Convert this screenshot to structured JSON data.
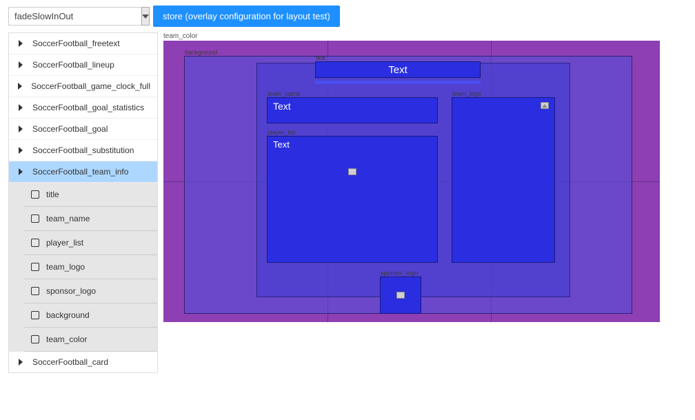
{
  "topbar": {
    "select_value": "fadeSlowInOut",
    "store_button": "store (overlay configuration for layout test)"
  },
  "sidebar": {
    "items": [
      {
        "label": "SoccerFootball_freetext",
        "kind": "parent"
      },
      {
        "label": "SoccerFootball_lineup",
        "kind": "parent"
      },
      {
        "label": "SoccerFootball_game_clock_full",
        "kind": "parent"
      },
      {
        "label": "SoccerFootball_goal_statistics",
        "kind": "parent"
      },
      {
        "label": "SoccerFootball_goal",
        "kind": "parent"
      },
      {
        "label": "SoccerFootball_substitution",
        "kind": "parent"
      },
      {
        "label": "SoccerFootball_team_info",
        "kind": "parent",
        "selected": true
      },
      {
        "label": "title",
        "kind": "child"
      },
      {
        "label": "team_name",
        "kind": "child"
      },
      {
        "label": "player_list",
        "kind": "child"
      },
      {
        "label": "team_logo",
        "kind": "child"
      },
      {
        "label": "sponsor_logo",
        "kind": "child"
      },
      {
        "label": "background",
        "kind": "child"
      },
      {
        "label": "team_color",
        "kind": "child"
      },
      {
        "label": "SoccerFootball_card",
        "kind": "parent"
      }
    ]
  },
  "canvas": {
    "root_label": "team_color",
    "background_label": "background",
    "title_label": "title",
    "title_text": "Text",
    "team_name_label": "team_name",
    "team_name_text": "Text",
    "team_logo_label": "team_logo",
    "player_list_label": "player_list",
    "player_list_text": "Text",
    "sponsor_logo_label": "sponsor_logo"
  }
}
